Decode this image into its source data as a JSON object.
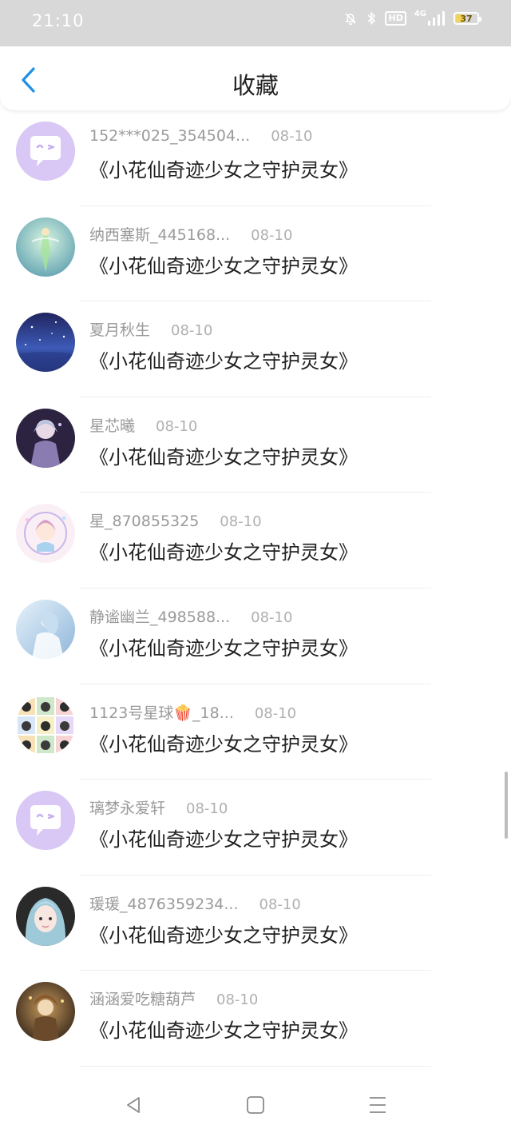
{
  "status_bar": {
    "time": "21:10",
    "network": "4G",
    "hd": "HD",
    "battery_percent": 37,
    "battery_label": "37"
  },
  "header": {
    "title": "收藏"
  },
  "colors": {
    "accent": "#1e90e8",
    "default_avatar_bg": "#d9c8f5",
    "battery": "#f3d35a"
  },
  "items": [
    {
      "username": "152***025_354504...",
      "date": "08-10",
      "title": "《小花仙奇迹少女之守护灵女》",
      "avatar": "default-chat-avatar"
    },
    {
      "username": "纳西塞斯_445168...",
      "date": "08-10",
      "title": "《小花仙奇迹少女之守护灵女》",
      "avatar": "green-fairy-avatar"
    },
    {
      "username": "夏月秋生",
      "date": "08-10",
      "title": "《小花仙奇迹少女之守护灵女》",
      "avatar": "starry-sky-avatar"
    },
    {
      "username": "星芯曦",
      "date": "08-10",
      "title": "《小花仙奇迹少女之守护灵女》",
      "avatar": "dark-anime-girl-avatar"
    },
    {
      "username": "星_870855325",
      "date": "08-10",
      "title": "《小花仙奇迹少女之守护灵女》",
      "avatar": "pastel-anime-girl-avatar"
    },
    {
      "username": "静谧幽兰_498588...",
      "date": "08-10",
      "title": "《小花仙奇迹少女之守护灵女》",
      "avatar": "blue-fairy-avatar"
    },
    {
      "username": "1123号星球🍿_18...",
      "date": "08-10",
      "title": "《小花仙奇迹少女之守护灵女》",
      "avatar": "cartoon-grid-avatar"
    },
    {
      "username": "璃梦永爱轩",
      "date": "08-10",
      "title": "《小花仙奇迹少女之守护灵女》",
      "avatar": "default-chat-avatar"
    },
    {
      "username": "瑗瑗_4876359234...",
      "date": "08-10",
      "title": "《小花仙奇迹少女之守护灵女》",
      "avatar": "blue-hair-girl-avatar"
    },
    {
      "username": "涵涵爱吃糖葫芦",
      "date": "08-10",
      "title": "《小花仙奇迹少女之守护灵女》",
      "avatar": "brown-fairy-avatar"
    }
  ]
}
